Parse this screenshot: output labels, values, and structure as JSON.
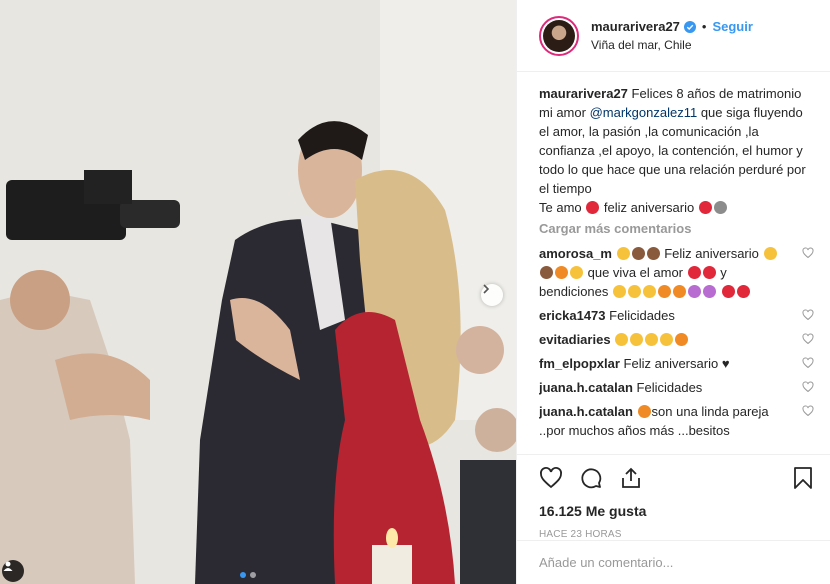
{
  "post": {
    "username": "maurarivera27",
    "follow_label": "Seguir",
    "separator": "•",
    "location": "Viña del mar, Chile"
  },
  "caption": {
    "username": "maurarivera27",
    "text_1": "Felices 8 años de matrimonio mi amor",
    "mention": "@markgonzalez11",
    "text_2": "que siga fluyendo el amor, la pasión ,la comunicación ,la confianza ,el apoyo, la contención, el humor y todo lo que hace que una relación perduré por el tiempo",
    "text_3": "Te amo",
    "text_4": "feliz aniversario"
  },
  "load_more": "Cargar más comentarios",
  "comments": [
    {
      "user": "amorosa_m",
      "text_1": "Feliz aniversario",
      "text_2": "que viva el amor",
      "text_3": "y bendiciones"
    },
    {
      "user": "ericka1473",
      "text": "Felicidades"
    },
    {
      "user": "evitadiaries",
      "text": ""
    },
    {
      "user": "fm_elpopxlar",
      "text": "Feliz aniversario"
    },
    {
      "user": "juana.h.catalan",
      "text": "Felicidades"
    },
    {
      "user": "juana.h.catalan",
      "text": "son una linda pareja ..por muchos años más ...besitos"
    }
  ],
  "likes": "16.125 Me gusta",
  "time_ago": "HACE 23 HORAS",
  "add_comment_placeholder": "Añade un comentario...",
  "colors": {
    "accent": "#3897f0",
    "heart": "#ed4956",
    "mention": "#003569",
    "muted": "#999999"
  },
  "icons": [
    "verified-badge-icon",
    "heart-icon",
    "comment-icon",
    "share-icon",
    "bookmark-icon",
    "chevron-right-icon",
    "user-tag-icon"
  ]
}
